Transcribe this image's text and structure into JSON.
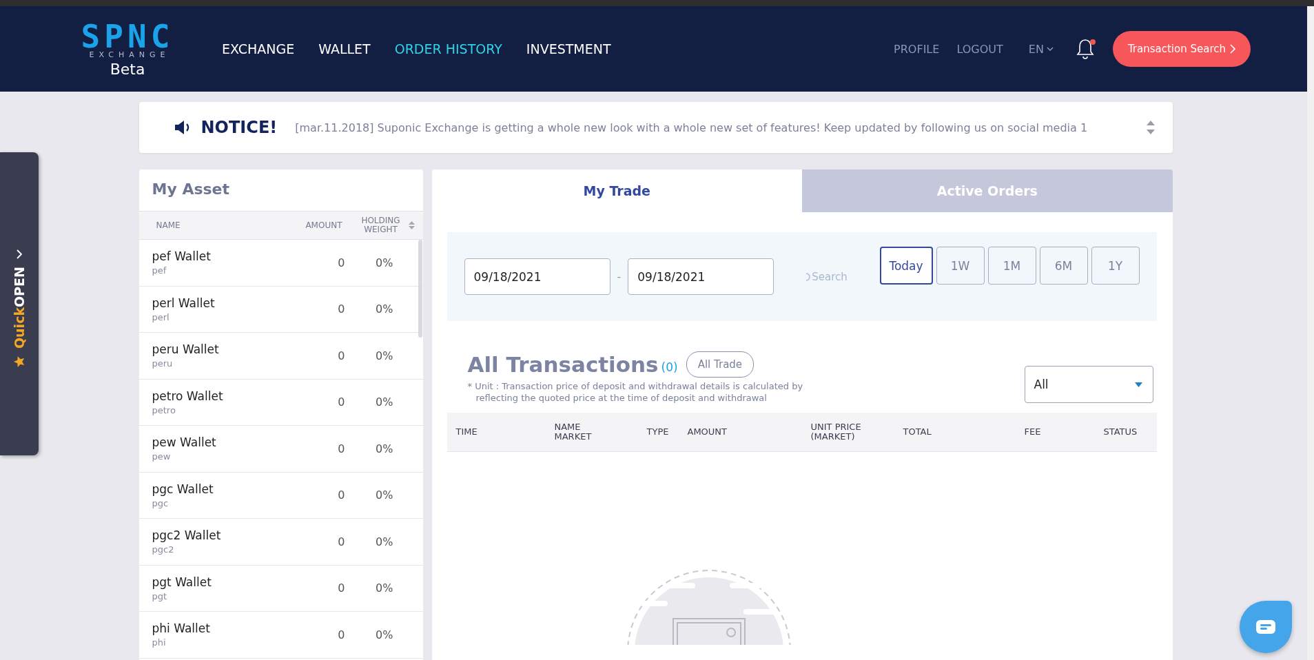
{
  "header": {
    "logo": {
      "title": "SPNC",
      "subtitle": "EXCHANGE",
      "badge": "Beta"
    },
    "nav": [
      {
        "label": "EXCHANGE",
        "selected": false
      },
      {
        "label": "WALLET",
        "selected": false
      },
      {
        "label": "ORDER HISTORY",
        "selected": true
      },
      {
        "label": "INVESTMENT",
        "selected": false
      }
    ],
    "user_links": [
      "PROFILE",
      "LOGOUT"
    ],
    "language": "EN",
    "notifications": {
      "unread": true
    },
    "search_button": "Transaction Search"
  },
  "quick_panel": {
    "label_1": "Quick",
    "label_2": "OPEN"
  },
  "notice": {
    "title": "NOTICE!",
    "text": "[mar.11.2018] Suponic Exchange is getting a whole new look with a whole new set of features! Keep updated by following us on social media 1"
  },
  "asset": {
    "title": "My Asset",
    "columns": [
      "NAME",
      "AMOUNT",
      "HOLDING\nWEIGHT"
    ],
    "rows": [
      {
        "name": "pef Wallet",
        "symbol": "pef",
        "amount": "0",
        "weight": "0%"
      },
      {
        "name": "perl Wallet",
        "symbol": "perl",
        "amount": "0",
        "weight": "0%"
      },
      {
        "name": "peru Wallet",
        "symbol": "peru",
        "amount": "0",
        "weight": "0%"
      },
      {
        "name": "petro Wallet",
        "symbol": "petro",
        "amount": "0",
        "weight": "0%"
      },
      {
        "name": "pew Wallet",
        "symbol": "pew",
        "amount": "0",
        "weight": "0%"
      },
      {
        "name": "pgc Wallet",
        "symbol": "pgc",
        "amount": "0",
        "weight": "0%"
      },
      {
        "name": "pgc2 Wallet",
        "symbol": "pgc2",
        "amount": "0",
        "weight": "0%"
      },
      {
        "name": "pgt Wallet",
        "symbol": "pgt",
        "amount": "0",
        "weight": "0%"
      },
      {
        "name": "phi Wallet",
        "symbol": "phi",
        "amount": "0",
        "weight": "0%"
      }
    ]
  },
  "trade": {
    "tabs": [
      {
        "label": "My Trade",
        "selected": true
      },
      {
        "label": "Active Orders",
        "selected": false
      }
    ],
    "date_from": "09/18/2021",
    "separator": "-",
    "date_to": "09/18/2021",
    "search_label": "Search",
    "periods": [
      {
        "label": "Today",
        "selected": true
      },
      {
        "label": "1W",
        "selected": false
      },
      {
        "label": "1M",
        "selected": false
      },
      {
        "label": "6M",
        "selected": false
      },
      {
        "label": "1Y",
        "selected": false
      }
    ],
    "title": "All Transactions",
    "count": "(0)",
    "filter_button": "All Trade",
    "note": "* Unit : Transaction price of deposit and withdrawal details is calculated by reflecting the quoted price at the time of deposit and withdrawal",
    "type_select": "All",
    "columns": [
      "TIME",
      "NAME\nMARKET",
      "TYPE",
      "AMOUNT",
      "UNIT PRICE\n(MARKET)",
      "TOTAL",
      "FEE",
      "STATUS"
    ]
  }
}
